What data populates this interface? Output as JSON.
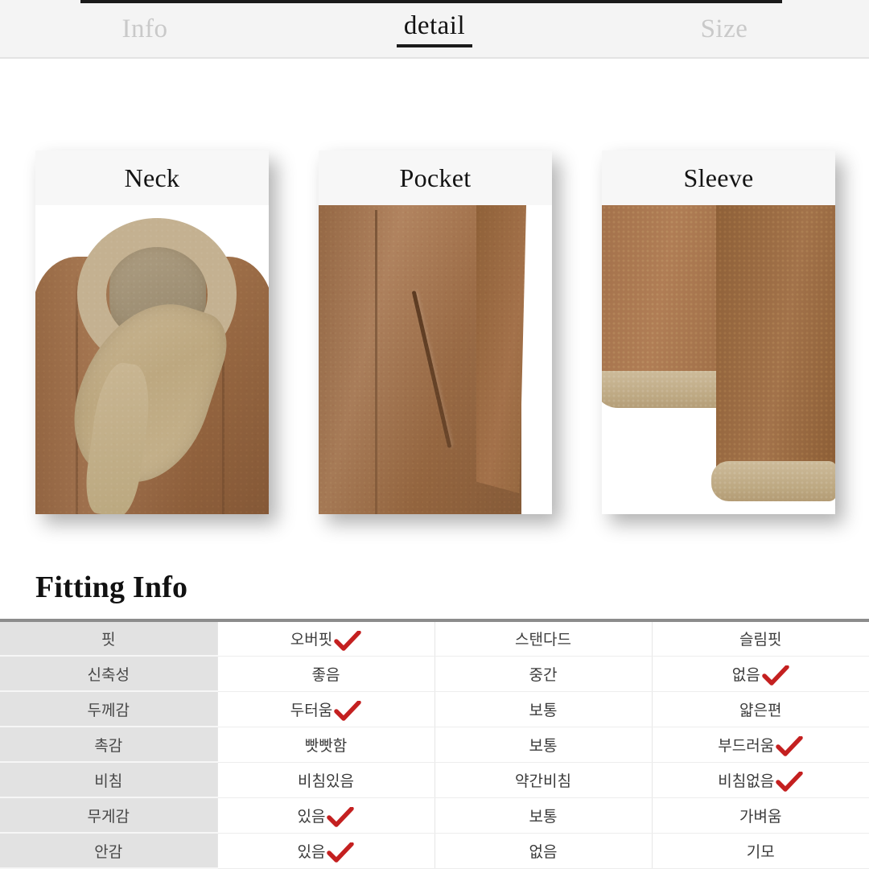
{
  "tabs": [
    {
      "label": "Info",
      "active": false
    },
    {
      "label": "detail",
      "active": true
    },
    {
      "label": "Size",
      "active": false
    }
  ],
  "detail_cards": [
    {
      "title": "Neck",
      "photo": "shearling-coat-collar"
    },
    {
      "title": "Pocket",
      "photo": "suede-coat-pocket"
    },
    {
      "title": "Sleeve",
      "photo": "shearling-sleeve-cuff"
    }
  ],
  "fitting": {
    "heading": "Fitting Info",
    "rows": [
      {
        "label": "핏",
        "options": [
          {
            "text": "오버핏",
            "checked": true
          },
          {
            "text": "스탠다드",
            "checked": false
          },
          {
            "text": "슬림핏",
            "checked": false
          }
        ]
      },
      {
        "label": "신축성",
        "options": [
          {
            "text": "좋음",
            "checked": false
          },
          {
            "text": "중간",
            "checked": false
          },
          {
            "text": "없음",
            "checked": true
          }
        ]
      },
      {
        "label": "두께감",
        "options": [
          {
            "text": "두터움",
            "checked": true
          },
          {
            "text": "보통",
            "checked": false
          },
          {
            "text": "얇은편",
            "checked": false
          }
        ]
      },
      {
        "label": "촉감",
        "options": [
          {
            "text": "빳빳함",
            "checked": false
          },
          {
            "text": "보통",
            "checked": false
          },
          {
            "text": "부드러움",
            "checked": true
          }
        ]
      },
      {
        "label": "비침",
        "options": [
          {
            "text": "비침있음",
            "checked": false
          },
          {
            "text": "약간비침",
            "checked": false
          },
          {
            "text": "비침없음",
            "checked": true
          }
        ]
      },
      {
        "label": "무게감",
        "options": [
          {
            "text": "있음",
            "checked": true
          },
          {
            "text": "보통",
            "checked": false
          },
          {
            "text": "가벼움",
            "checked": false
          }
        ]
      },
      {
        "label": "안감",
        "options": [
          {
            "text": "있음",
            "checked": true
          },
          {
            "text": "없음",
            "checked": false
          },
          {
            "text": "기모",
            "checked": false
          }
        ]
      }
    ]
  },
  "colors": {
    "check_mark": "#c42020",
    "tab_active_text": "#121212",
    "tab_inactive_text": "#c9c9c9",
    "tab_bar_bg": "#f4f4f4",
    "label_cell_bg": "#e2e2e2",
    "table_top_border": "#8c8c8c"
  }
}
